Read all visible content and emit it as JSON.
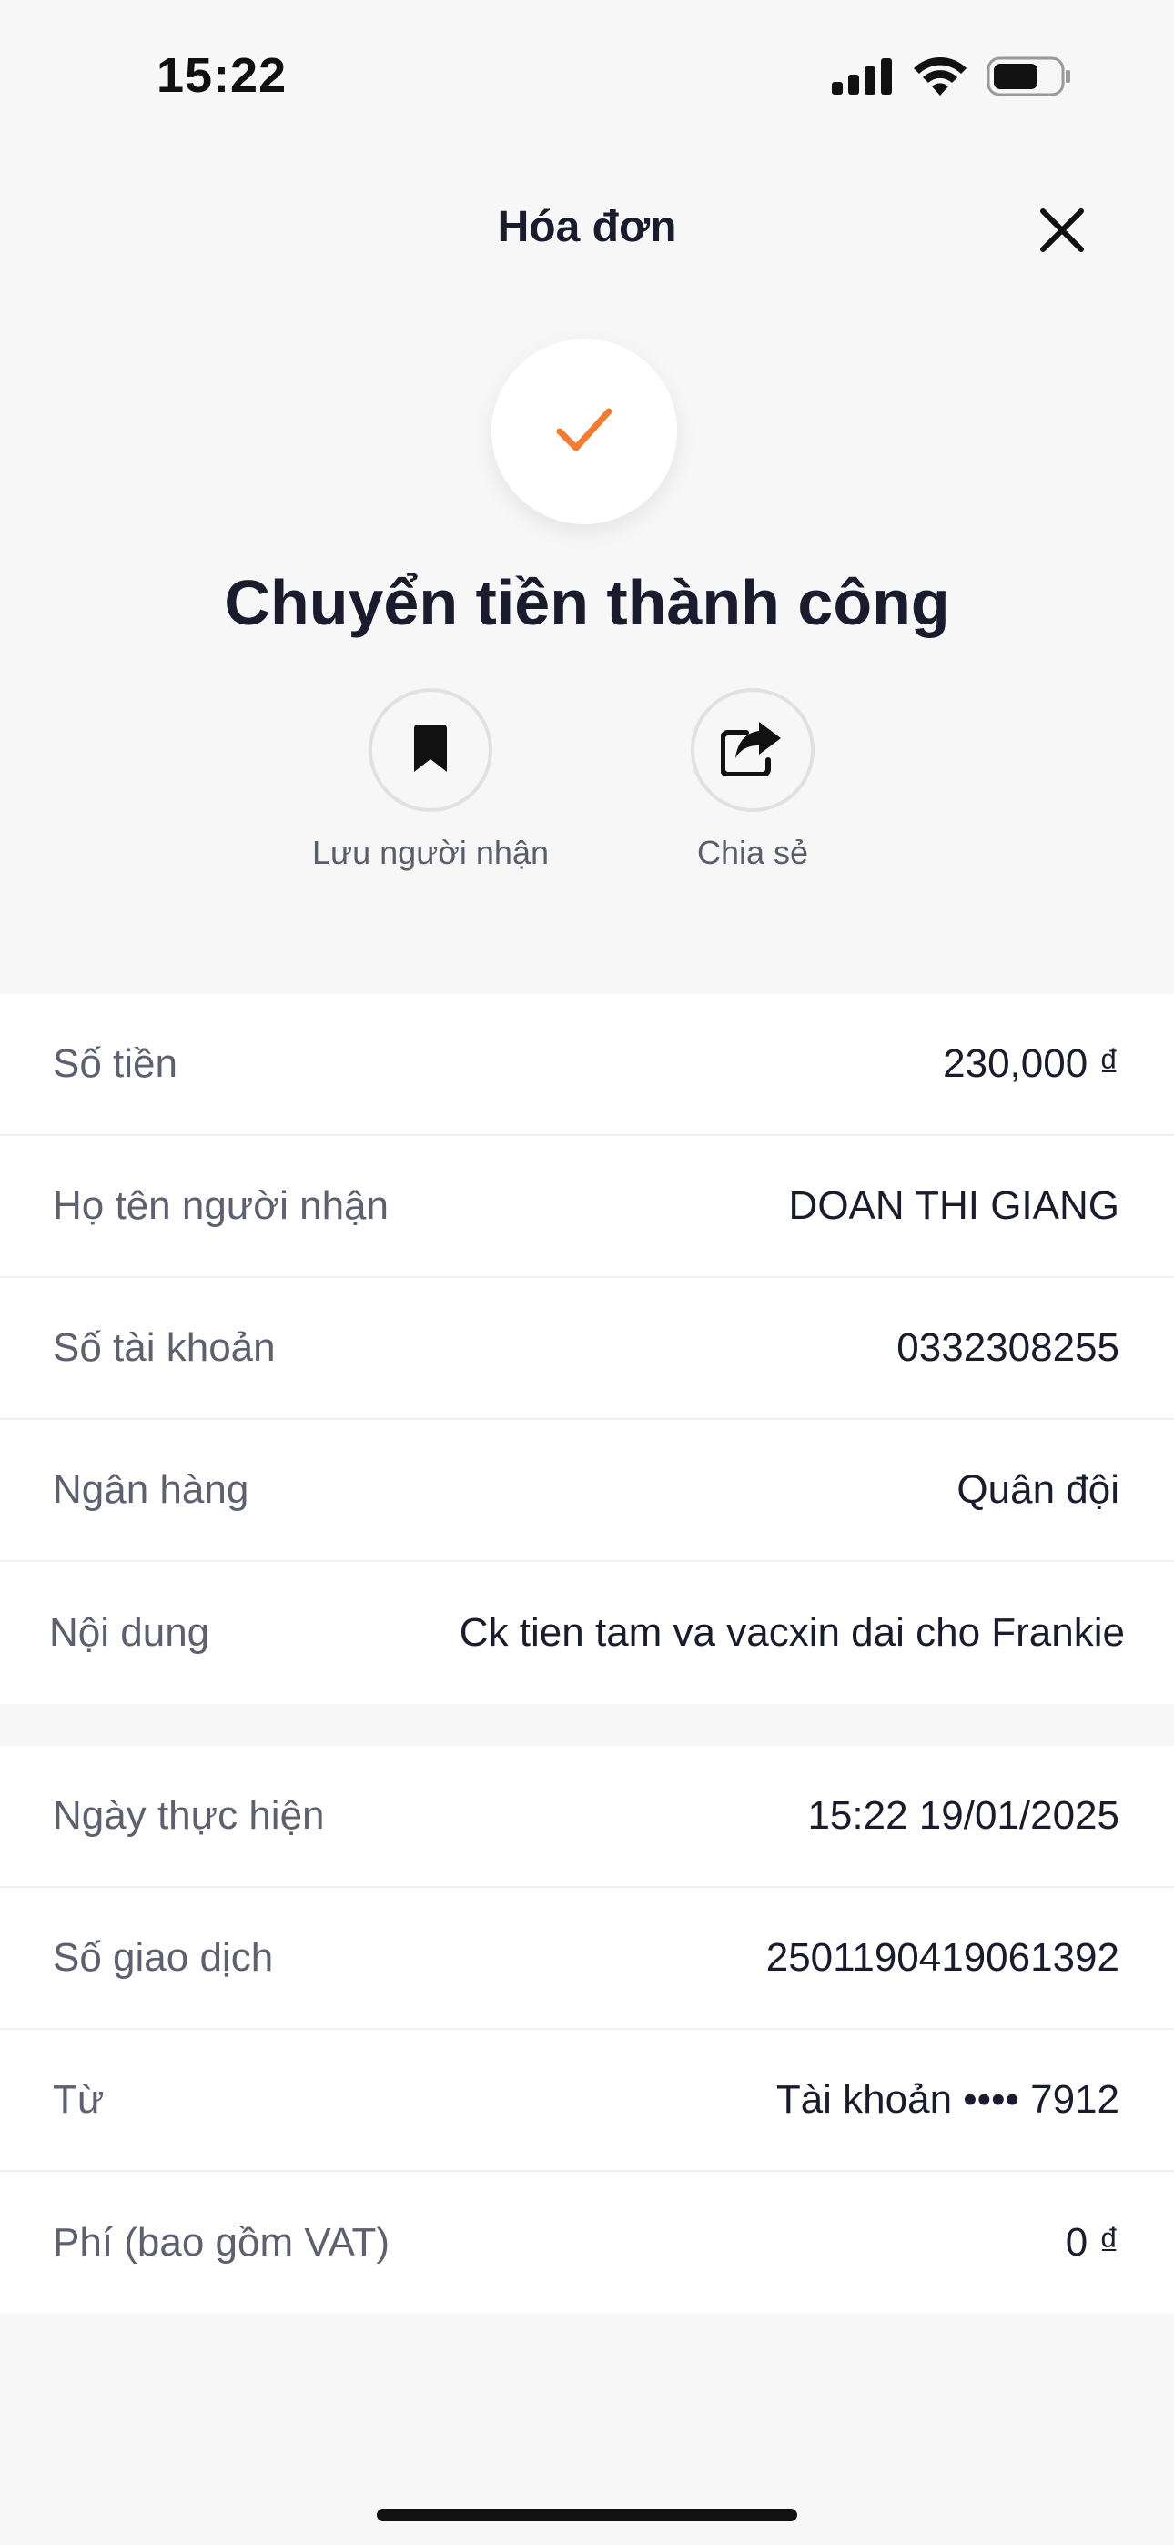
{
  "status_bar": {
    "time": "15:22",
    "icons": [
      "signal-icon",
      "wifi-icon",
      "battery-icon"
    ]
  },
  "header": {
    "title": "Hóa đơn",
    "close_icon": "close-icon"
  },
  "success": {
    "icon": "check-icon",
    "icon_color": "#f47b30",
    "title": "Chuyển tiền thành công"
  },
  "actions": [
    {
      "icon": "bookmark-icon",
      "label": "Lưu người nhận"
    },
    {
      "icon": "share-icon",
      "label": "Chia sẻ"
    }
  ],
  "details": [
    {
      "label": "Số tiền",
      "value": "230,000 ₫"
    },
    {
      "label": "Họ tên người nhận",
      "value": "DOAN THI GIANG"
    },
    {
      "label": "Số tài khoản",
      "value": "0332308255"
    },
    {
      "label": "Ngân hàng",
      "value": "Quân đội"
    },
    {
      "label": "Nội dung",
      "value": "Ck tien tam va vacxin dai cho Frankie"
    }
  ],
  "transaction": [
    {
      "label": "Ngày thực hiện",
      "value": "15:22 19/01/2025"
    },
    {
      "label": "Số giao dịch",
      "value": "2501190419061392"
    },
    {
      "label": "Từ",
      "value": "Tài khoản •••• 7912"
    },
    {
      "label": "Phí (bao gồm VAT)",
      "value": "0 ₫"
    }
  ]
}
